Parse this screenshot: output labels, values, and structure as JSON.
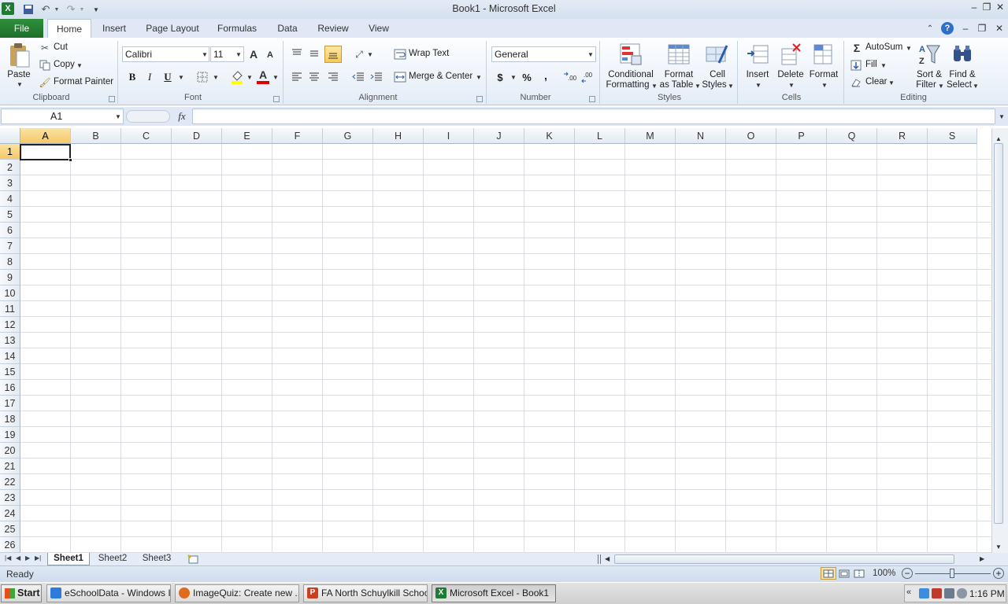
{
  "window": {
    "title": "Book1  -  Microsoft Excel"
  },
  "tabs": {
    "file": "File",
    "home": "Home",
    "insert": "Insert",
    "page_layout": "Page Layout",
    "formulas": "Formulas",
    "data": "Data",
    "review": "Review",
    "view": "View"
  },
  "clipboard": {
    "paste": "Paste",
    "cut": "Cut",
    "copy": "Copy",
    "format_painter": "Format Painter",
    "label": "Clipboard"
  },
  "font": {
    "name": "Calibri",
    "size": "11",
    "bold": "B",
    "italic": "I",
    "underline": "U",
    "label": "Font",
    "grow": "A",
    "shrink": "A",
    "color_glyph": "A"
  },
  "alignment": {
    "wrap_text": "Wrap Text",
    "merge_center": "Merge & Center",
    "label": "Alignment"
  },
  "number": {
    "format": "General",
    "currency": "$",
    "percent": "%",
    "comma": ",",
    "inc_dec": ".00",
    "label": "Number"
  },
  "styles": {
    "conditional_1": "Conditional",
    "conditional_2": "Formatting",
    "format_table_1": "Format",
    "format_table_2": "as Table",
    "cell_styles_1": "Cell",
    "cell_styles_2": "Styles",
    "label": "Styles"
  },
  "cells": {
    "insert": "Insert",
    "delete": "Delete",
    "format": "Format",
    "label": "Cells"
  },
  "editing": {
    "autosum": "AutoSum",
    "fill": "Fill",
    "clear": "Clear",
    "sort_1": "Sort &",
    "sort_2": "Filter",
    "find_1": "Find &",
    "find_2": "Select",
    "sigma": "Σ",
    "label": "Editing"
  },
  "formula_bar": {
    "name_box": "A1",
    "fx": "fx",
    "value": ""
  },
  "columns": [
    "A",
    "B",
    "C",
    "D",
    "E",
    "F",
    "G",
    "H",
    "I",
    "J",
    "K",
    "L",
    "M",
    "N",
    "O",
    "P",
    "Q",
    "R",
    "S"
  ],
  "rows": [
    "1",
    "2",
    "3",
    "4",
    "5",
    "6",
    "7",
    "8",
    "9",
    "10",
    "11",
    "12",
    "13",
    "14",
    "15",
    "16",
    "17",
    "18",
    "19",
    "20",
    "21",
    "22",
    "23",
    "24",
    "25",
    "26"
  ],
  "sheets": [
    "Sheet1",
    "Sheet2",
    "Sheet3"
  ],
  "status": {
    "ready": "Ready",
    "zoom": "100%"
  },
  "taskbar": {
    "start": "Start",
    "items": [
      "eSchoolData - Windows I...",
      "ImageQuiz: Create new ...",
      "FA North Schuylkill Schoo...",
      "Microsoft Excel - Book1"
    ],
    "clock": "1:16 PM"
  },
  "colors": {
    "accent": "#1f6e2a",
    "selection": "#f5c86a"
  }
}
